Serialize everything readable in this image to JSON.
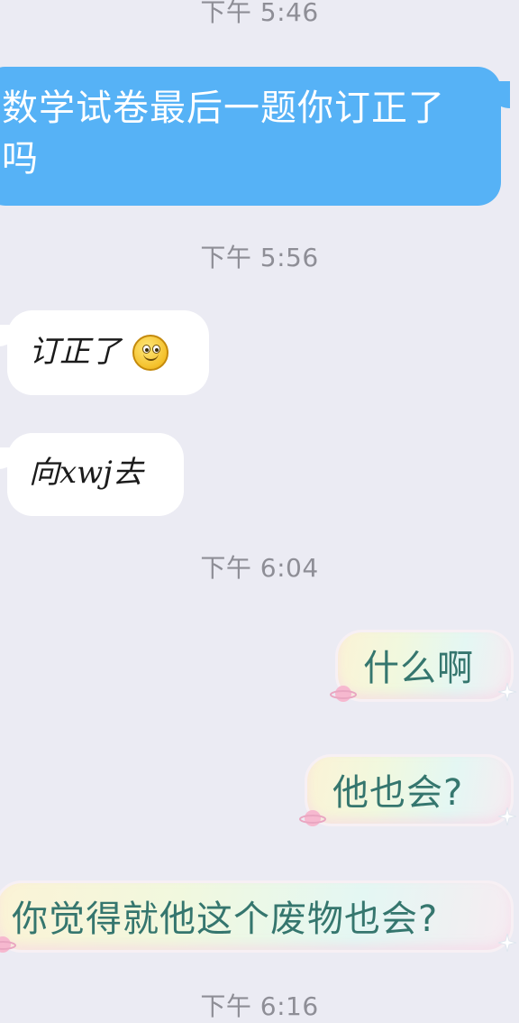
{
  "timestamps": [
    "下午 5:46",
    "下午 5:56",
    "下午 6:04",
    "下午 6:16"
  ],
  "messages": [
    {
      "side": "outgoing",
      "style": "blue",
      "text": "数学试卷最后一题你订正了吗"
    },
    {
      "side": "incoming",
      "style": "white",
      "text": "订正了",
      "emoji": "smiley-icon"
    },
    {
      "side": "incoming",
      "style": "white",
      "text": "向xwj去"
    },
    {
      "side": "outgoing",
      "style": "pastel",
      "text": "什么啊"
    },
    {
      "side": "outgoing",
      "style": "pastel",
      "text": "他也会?"
    },
    {
      "side": "outgoing",
      "style": "pastel",
      "text": "你觉得就他这个废物也会?"
    }
  ],
  "colors": {
    "background": "#ebebf3",
    "blue_bubble": "#56b2f6",
    "white_bubble": "#ffffff",
    "pastel_text": "#35766e",
    "timestamp_text": "#8e8e96"
  }
}
